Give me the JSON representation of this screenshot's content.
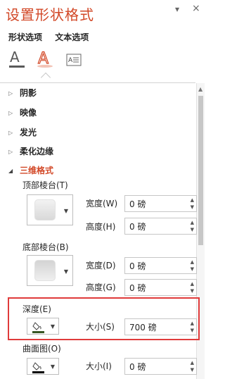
{
  "pane": {
    "title": "设置形状格式",
    "collapse_glyph": "▾",
    "close_glyph": "×"
  },
  "tabs": [
    "形状选项",
    "文本选项"
  ],
  "icon_tabs": [
    "text-fill-outline-icon",
    "text-effects-icon",
    "textbox-icon"
  ],
  "sections": {
    "shadow": "阴影",
    "reflection": "映像",
    "glow": "发光",
    "soft_edges": "柔化边缘",
    "format_3d": "三维格式"
  },
  "format3d": {
    "top_bevel": {
      "label": "顶部棱台(T)",
      "width_label": "宽度(W)",
      "width_value": "0 磅",
      "height_label": "高度(H)",
      "height_value": "0 磅"
    },
    "bottom_bevel": {
      "label": "底部棱台(B)",
      "width_label": "宽度(D)",
      "width_value": "0 磅",
      "height_label": "高度(G)",
      "height_value": "0 磅"
    },
    "depth": {
      "label": "深度(E)",
      "size_label": "大小(S)",
      "size_value": "700 磅"
    },
    "contour": {
      "label": "曲面图(O)",
      "size_label": "大小(I)",
      "size_value": "0 磅"
    }
  },
  "colors": {
    "accent": "#d24726",
    "highlight_box": "#e03b3b",
    "depth_color": "#375623",
    "contour_color": "#000000"
  }
}
